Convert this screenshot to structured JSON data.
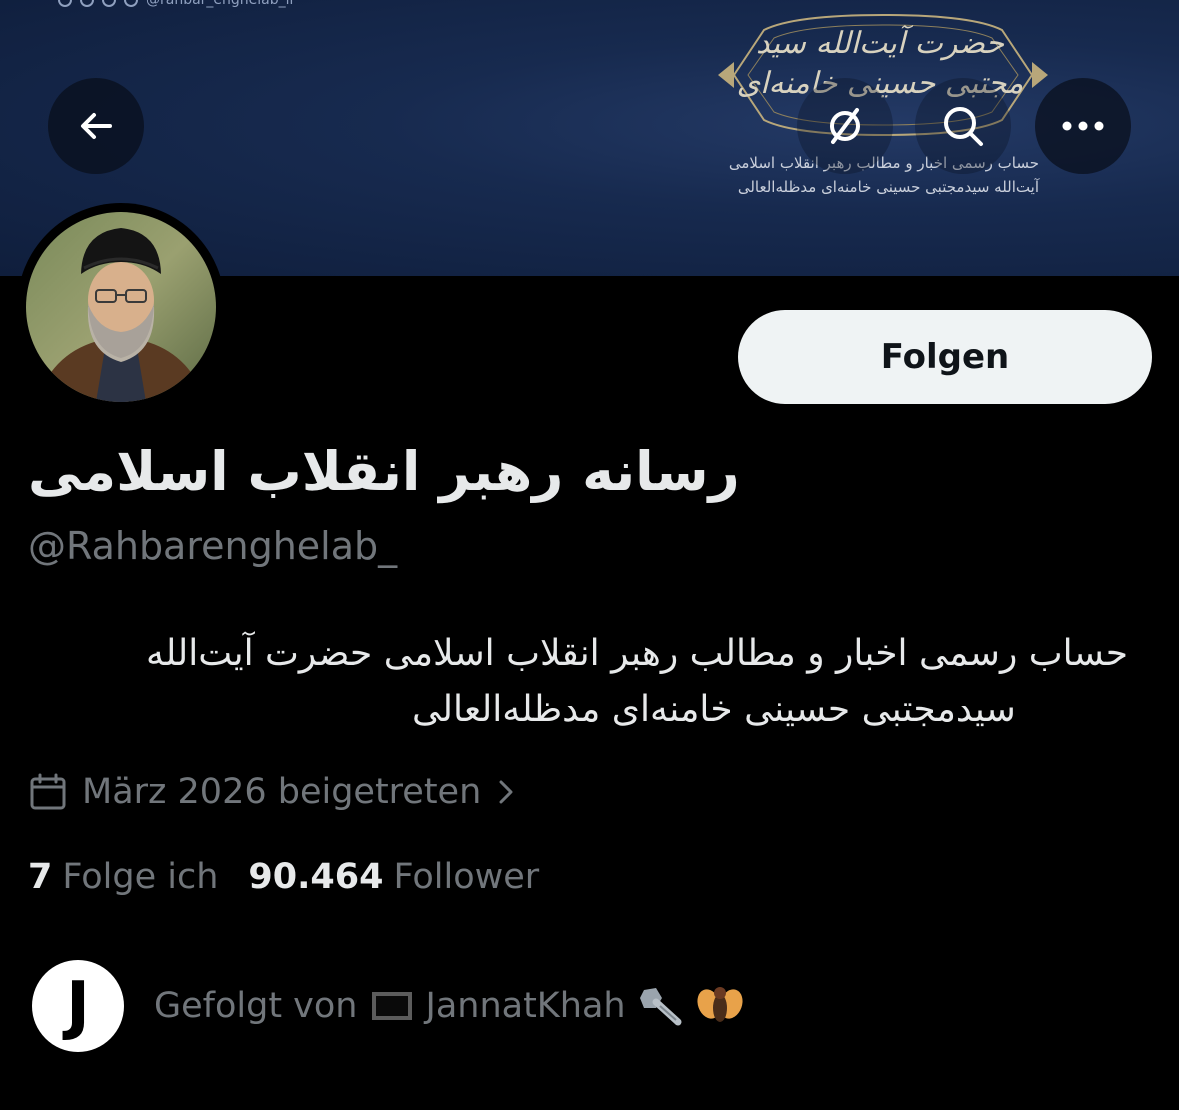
{
  "banner": {
    "social_handle": "@rahbar_enghelab_ir",
    "emblem_title": "حضرت آیت‌الله سید مجتبی حسینی خامنه‌ای",
    "line1": "حساب رسمی اخبار و مطالب رهبر انقلاب اسلامی",
    "line2": "آیت‌الله سید‌مجتبی حسینی خامنه‌ای مدظله‌العالی"
  },
  "header": {
    "back_icon": "arrow-left-icon",
    "grok_icon": "grok-icon",
    "search_icon": "search-icon",
    "more_icon": "more-horizontal-icon"
  },
  "profile": {
    "display_name": "رسانه رهبر انقلاب اسلامی",
    "handle": "@Rahbarenghelab_",
    "bio_line1": "حساب رسمی اخبار و مطالب رهبر انقلاب اسلامی حضرت آیت‌الله",
    "bio_line2": "سیدمجتبی حسینی خامنه‌ای مدظله‌العالی",
    "joined": "März 2026 beigetreten"
  },
  "actions": {
    "follow_label": "Folgen"
  },
  "stats": {
    "following_count": "7",
    "following_label": "Folge ich",
    "followers_count": "90.464",
    "followers_label": "Follower"
  },
  "followed_by": {
    "prefix": "Gefolgt von",
    "name": "JannatKhah",
    "avatar_letter": "J"
  },
  "colors": {
    "background": "#000000",
    "banner": "#172a4f",
    "text_primary": "#e7e9ea",
    "text_secondary": "#71767b",
    "follow_button_bg": "#eff3f4",
    "follow_button_text": "#0f1419"
  }
}
